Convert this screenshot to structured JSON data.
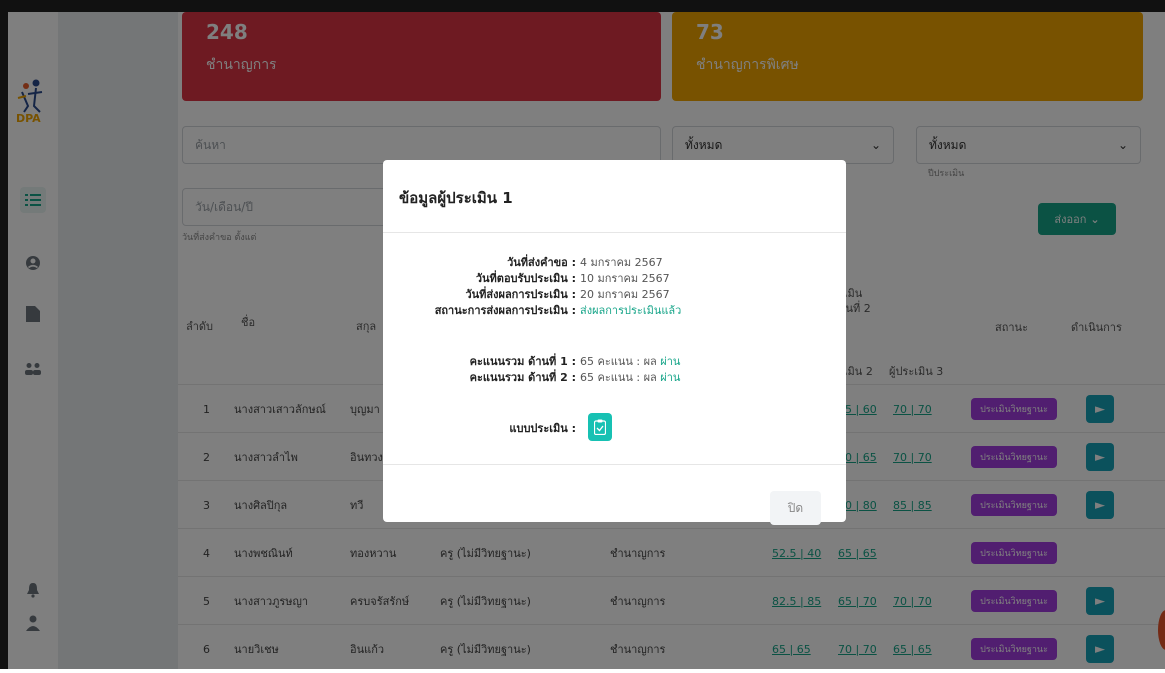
{
  "cards": [
    {
      "number": "248",
      "label": "ชำนาญการ",
      "color": "#dc3545"
    },
    {
      "number": "73",
      "label": "ชำนาญการพิเศษ",
      "color": "#f0a500"
    }
  ],
  "filters": {
    "search_placeholder": "ค้นหา",
    "type_select": "ทั้งหมด",
    "year_select": "ทั้งหมด",
    "year_caption": "ปีประเมิน",
    "date_placeholder": "วัน/เดือน/ปี",
    "date_caption": "วันที่ส่งคำขอ ตั้งแต่",
    "export_label": "ส่งออก"
  },
  "table": {
    "headers": {
      "no": "ลำดับ",
      "name": "ชื่อ",
      "school": "สกุล",
      "eval_group": "ประเมิน",
      "eval_group_sub": "| ด้านที่ 2",
      "eval2": "ประเมิน 2",
      "eval3": "ผู้ประเมิน 3",
      "status": "สถานะ",
      "actions": "ดำเนินการ"
    },
    "rows": [
      {
        "no": "1",
        "name": "นางสาวเสาวลักษณ์",
        "surname": "บุญมา",
        "position": "",
        "level": "",
        "s1": "",
        "s2": "65 | 60",
        "s3": "70 | 70",
        "status": "ประเมินวิทยฐานะ",
        "action": true
      },
      {
        "no": "2",
        "name": "นางสาวลำไพ",
        "surname": "อินทวง",
        "position": "",
        "level": "",
        "s1": "",
        "s2": "60 | 65",
        "s3": "70 | 70",
        "status": "ประเมินวิทยฐานะ",
        "action": true
      },
      {
        "no": "3",
        "name": "นางศิลปิกุล",
        "surname": "ทวี",
        "position": "",
        "level": "",
        "s1": "",
        "s2": "80 | 80",
        "s3": "85 | 85",
        "status": "ประเมินวิทยฐานะ",
        "action": true
      },
      {
        "no": "4",
        "name": "นางพชณินท์",
        "surname": "ทองหวาน",
        "position": "ครู (ไม่มีวิทยฐานะ)",
        "level": "ชำนาญการ",
        "s1": "52.5 | 40",
        "s2": "65 | 65",
        "s3": "",
        "status": "ประเมินวิทยฐานะ",
        "action": false
      },
      {
        "no": "5",
        "name": "นางสาวภูรษญา",
        "surname": "ครบจรัสรักษ์",
        "position": "ครู (ไม่มีวิทยฐานะ)",
        "level": "ชำนาญการ",
        "s1": "82.5 | 85",
        "s2": "65 | 70",
        "s3": "70 | 70",
        "status": "ประเมินวิทยฐานะ",
        "action": true
      },
      {
        "no": "6",
        "name": "นายวิเชษ",
        "surname": "อินแก้ว",
        "position": "ครู (ไม่มีวิทยฐานะ)",
        "level": "ชำนาญการ",
        "s1": "65 | 65",
        "s2": "70 | 70",
        "s3": "65 | 65",
        "status": "ประเมินวิทยฐานะ",
        "action": true
      }
    ]
  },
  "modal": {
    "title": "ข้อมูลผู้ประเมิน 1",
    "fields": [
      {
        "label": "วันที่ส่งคำขอ :",
        "value": "4 มกราคม 2567"
      },
      {
        "label": "วันที่ตอบรับประเมิน :",
        "value": "10 มกราคม 2567"
      },
      {
        "label": "วันที่ส่งผลการประเมิน :",
        "value": "20 มกราคม 2567"
      },
      {
        "label": "สถานะการส่งผลการประเมิน :",
        "value": "ส่งผลการประเมินแล้ว"
      }
    ],
    "scores": [
      {
        "label": "คะแนนรวม ด้านที่ 1 :",
        "value": "65 คะแนน : ผล",
        "result": "ผ่าน"
      },
      {
        "label": "คะแนนรวม ด้านที่ 2 :",
        "value": "65 คะแนน : ผล",
        "result": "ผ่าน"
      }
    ],
    "form_label": "แบบประเมิน :",
    "close_label": "ปิด"
  },
  "colors": {
    "accent": "#17a589",
    "danger": "#dc3545",
    "warning": "#f0a500",
    "badge": "#a23de0",
    "action": "#17a2b8"
  }
}
